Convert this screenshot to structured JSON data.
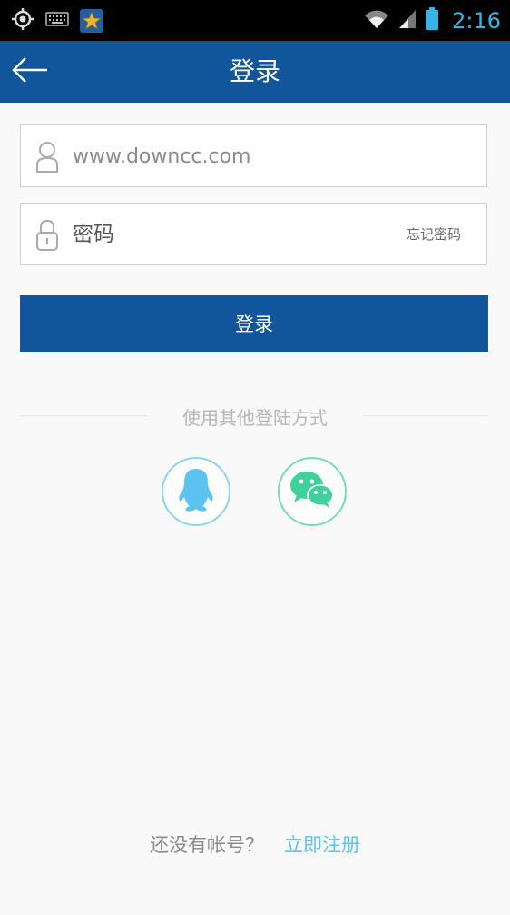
{
  "status_bar": {
    "time": "2:16",
    "icons": [
      "location-icon",
      "keyboard-icon",
      "app-star-icon",
      "wifi-icon",
      "signal-icon",
      "battery-icon"
    ],
    "clock_color": "#33b5e5"
  },
  "header": {
    "title": "登录",
    "back_icon": "arrow-left-icon",
    "background": "#11559b"
  },
  "form": {
    "username_placeholder": "www.downcc.com",
    "password_placeholder": "密码",
    "forgot_label": "忘记密码",
    "login_label": "登录"
  },
  "social": {
    "label": "使用其他登陆方式",
    "providers": [
      "qq-icon",
      "wechat-icon"
    ]
  },
  "footer": {
    "question": "还没有帐号？",
    "register_label": "立即注册",
    "register_color": "#5ec3ee"
  }
}
